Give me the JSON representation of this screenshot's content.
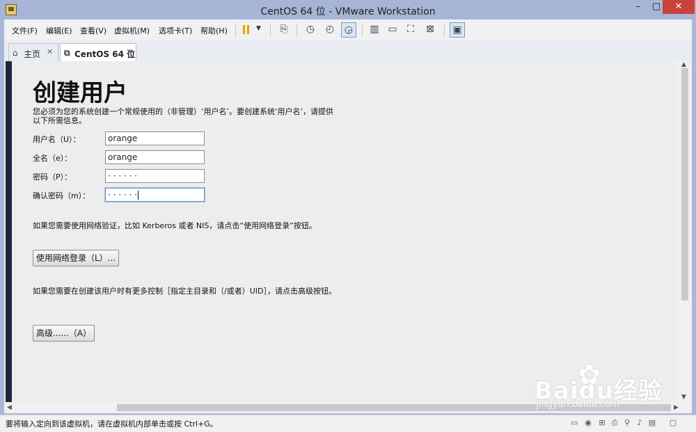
{
  "window": {
    "title": "CentOS 64 位 - VMware Workstation",
    "min": "–",
    "max": "□",
    "close": "✕"
  },
  "menu": [
    {
      "label": "文件(F)"
    },
    {
      "label": "编辑(E)"
    },
    {
      "label": "查看(V)"
    },
    {
      "label": "虚拟机(M)"
    },
    {
      "label": "选项卡(T)"
    },
    {
      "label": "帮助(H)"
    }
  ],
  "toolbar_icons": [
    "pause-icon",
    "send-ctrl-alt-del-icon",
    "snapshot-icon",
    "revert-snapshot-icon",
    "snapshot-manager-icon",
    "library-view-icon",
    "console-view-icon",
    "fullscreen-icon",
    "unity-icon",
    "thumbnail-view-icon"
  ],
  "tabs": [
    {
      "label": "主页",
      "close": "✕"
    },
    {
      "label": "CentOS 64 位",
      "close": "✕"
    }
  ],
  "form": {
    "heading": "创建用户",
    "description": "您必须为您的系统创建一个常规使用的（非管理）‘用户名’。要创建系统‘用户名’，请提供以下所需信息。",
    "fields": [
      {
        "label": "用户名（U）：",
        "value": "orange"
      },
      {
        "label": "全名（e）：",
        "value": "orange"
      },
      {
        "label": "密码（P）：",
        "value": "· · · · · ·"
      },
      {
        "label": "确认密码（m）：",
        "value": "· · · · · ·"
      }
    ],
    "network_text": "如果您需要使用网络验证，比如 Kerberos 或者 NIS，请点击“使用网络登录”按钮。",
    "network_button": "使用网络登录（L）...",
    "advanced_text": "如果您需要在创建该用户时有更多控制［指定主目录和（/或者）UID］，请点击高级按钮。",
    "advanced_button": "高级......（A）"
  },
  "status": {
    "text": "要将输入定向到该虚拟机，请在虚拟机内部单击或按 Ctrl+G。"
  },
  "watermark": {
    "logo": "Baidu经验",
    "sub": "jingyan.baidu.com"
  }
}
